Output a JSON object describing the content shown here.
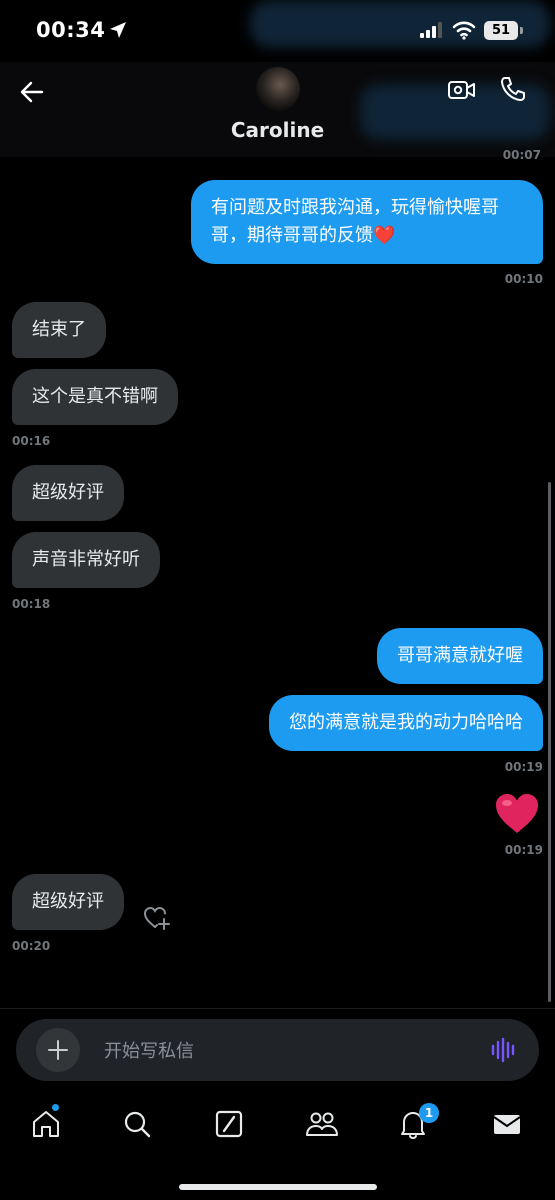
{
  "status_bar": {
    "time": "00:34",
    "battery": "51"
  },
  "header": {
    "contact_name": "Caroline",
    "partial_timestamp": "00:07",
    "icons": [
      "back-arrow-icon",
      "avatar",
      "video-call-icon",
      "phone-icon"
    ]
  },
  "messages": [
    {
      "id": "m1",
      "direction": "outgoing",
      "text": "有问题及时跟我沟通，玩得愉快喔哥哥，期待哥哥的反馈❤️",
      "timestamp": "00:10"
    },
    {
      "id": "m2",
      "direction": "incoming",
      "text": "结束了"
    },
    {
      "id": "m3",
      "direction": "incoming",
      "text": "这个是真不错啊",
      "timestamp": "00:16"
    },
    {
      "id": "m4",
      "direction": "incoming",
      "text": "超级好评"
    },
    {
      "id": "m5",
      "direction": "incoming",
      "text": "声音非常好听",
      "timestamp": "00:18"
    },
    {
      "id": "m6",
      "direction": "outgoing",
      "text": "哥哥满意就好喔"
    },
    {
      "id": "m7",
      "direction": "outgoing",
      "text": "您的满意就是我的动力哈哈哈",
      "timestamp": "00:19"
    },
    {
      "id": "m8",
      "direction": "outgoing",
      "text": "❤️",
      "timestamp": "00:19"
    },
    {
      "id": "m9",
      "direction": "incoming",
      "text": "超级好评",
      "timestamp": "00:20"
    }
  ],
  "composer": {
    "placeholder": "开始写私信"
  },
  "tab_bar": {
    "items": [
      "home-icon",
      "search-icon",
      "grok-icon",
      "communities-icon",
      "notifications-icon",
      "messages-icon"
    ],
    "notifications_badge": "1"
  },
  "colors": {
    "accent": "#1d9bf0",
    "incoming_bubble": "#2f3336",
    "background": "#000000",
    "heart": "#e0245e"
  }
}
